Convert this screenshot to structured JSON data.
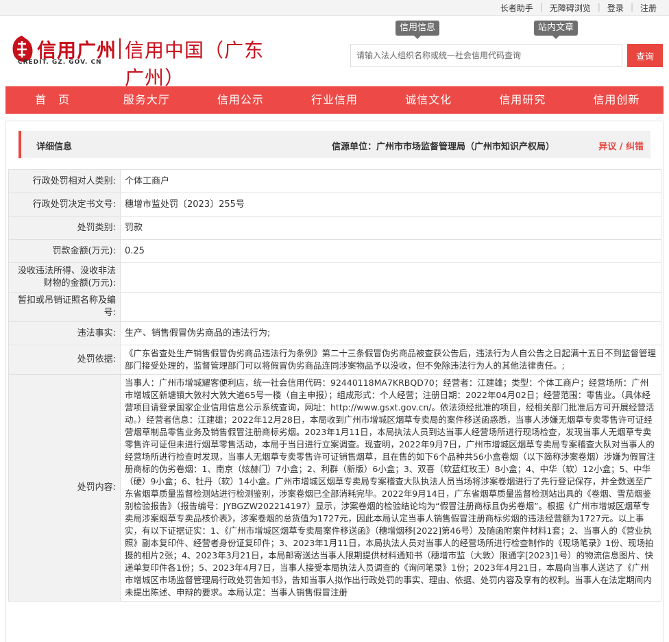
{
  "topbar": {
    "links": [
      "长者助手",
      "无障碍浏览",
      "登录",
      "注册"
    ]
  },
  "header": {
    "logo_main": "信用广州",
    "logo_side": "信用中国（广东广州）",
    "logo_sub": "CREDIT. GZ. GOV. CN",
    "search_tabs": [
      "信用信息",
      "站内文章"
    ],
    "search_placeholder": "请输入法人组织名称或统一社会信用代码查询",
    "search_button": "查询"
  },
  "nav": [
    "首　页",
    "服务大厅",
    "信用公示",
    "行业信用",
    "诚信文化",
    "信用研究",
    "信用创新"
  ],
  "detail": {
    "title": "详细信息",
    "source": "信源单位：广州市市场监督管理局（广州市知识产权局）",
    "objection": "异议 / 纠错"
  },
  "rows": [
    {
      "label": "行政处罚相对人类别:",
      "value": "个体工商户"
    },
    {
      "label": "行政处罚决定书文号:",
      "value": "穗增市监处罚〔2023〕255号"
    },
    {
      "label": "处罚类别:",
      "value": "罚款"
    },
    {
      "label": "罚款金额(万元):",
      "value": "0.25"
    },
    {
      "label": "没收违法所得、没收非法财物的金额(万元):",
      "value": ""
    },
    {
      "label": "暂扣或吊销证照名称及编号:",
      "value": ""
    },
    {
      "label": "违法事实:",
      "value": "生产、销售假冒伪劣商品的违法行为;"
    },
    {
      "label": "处罚依据:",
      "value": "《广东省查处生产销售假冒伪劣商品违法行为条例》第二十三条假冒伪劣商品被查获公告后，违法行为人自公告之日起满十五日不到监督管理部门接受处理的，监督管理部门可以将假冒伪劣商品连同涉案物品予以没收，但不免除违法行为人的其他法律责任。;"
    },
    {
      "label": "处罚内容:",
      "value": "当事人：广州市增城耀客便利店，统一社会信用代码：92440118MA7KRBQD70；经营者：江建雄；类型：个体工商户；经营场所：广州市增城区新塘镇大敦村大敦大道65号一楼（自主申报）；组成形式：个人经营；注册日期：2022年04月02日；经营范围：零售业。（具体经营项目请登录国家企业信用信息公示系统查询，网址：http://www.gsxt.gov.cn/。依法须经批准的项目，经相关部门批准后方可开展经营活动。）经营者信息：江建雄；2022年12月28日，本局收到广州市增城区烟草专卖局的案件移送函惑悉，当事人涉嫌无烟草专卖零售许可证经营烟草制品零售业务及销售假冒注册商标劣烟。2023年1月11日，本局执法人员到达当事人经营场所进行现场检查，发现当事人无烟草专卖零售许可证但未进行烟草零售活动，本局于当日进行立案调查。现查明，2022年9月7日，广州市增城区烟草专卖局专案稽查大队对当事人的经营场所进行检查时发现，当事人无烟草专卖零售许可证销售烟草，且在售的如下6个品种共56小盒卷烟（以下简称涉案卷烟）涉嫌为假冒注册商标的伪劣卷烟：1、南京（炫赫门）7小盒；2、利群（新版）6小盒；3、双喜（软蓝红玫王）8小盒；4、中华（软）12小盒；5、中华（硬）9小盒；6、牡丹（软）14小盒。广州市增城区烟草专卖局专案稽查大队执法人员当场将涉案卷烟进行了先行登记保存，并全数送至广东省烟草质量监督检测站进行检测鉴别，涉案卷烟已全部消耗完毕。2022年9月14日，广东省烟草质量监督检测站出具的《卷烟、雪茄烟鉴别检验报告》（报告编号：JYBGZW202214197）显示，涉案卷烟的检验结论均为“假冒注册商标且伪劣卷烟”。根据《广州市增城区烟草专卖局涉案烟草专卖品核价表》，涉案卷烟的总货值为1727元，因此本局认定当事人销售假冒注册商标劣烟的违法经营额为1727元。以上事实，有以下证据证实：1、《广州市增城区烟草专卖局案件移送函》（穗增烟移[2022]第46号）及随函附案件材料1套；2、当事人的《营业执照》副本复印件、经营者身份证复印件；3、2023年1月11日，本局执法人员对当事人的经营场所进行检查制作的《现场笔录》1份、现场拍摄的相片2张；4、2023年3月21日，本局邮寄送达当事人限期提供材料通知书（穗增市监（大敦）限通字[2023]1号）的物流信息图片、快递单复印件各1份；5、2023年4月7日，当事人接受本局执法人员调查的《询问笔录》1份；2023年4月21日，本局向当事人送达了《广州市增城区市场监督管理局行政处罚告知书》，告知当事人拟作出行政处罚的事实、理由、依据、处罚内容及享有的权利。当事人在法定期间内未提出陈述、申辩的要求。本局认定：当事人销售假冒注册"
    }
  ]
}
